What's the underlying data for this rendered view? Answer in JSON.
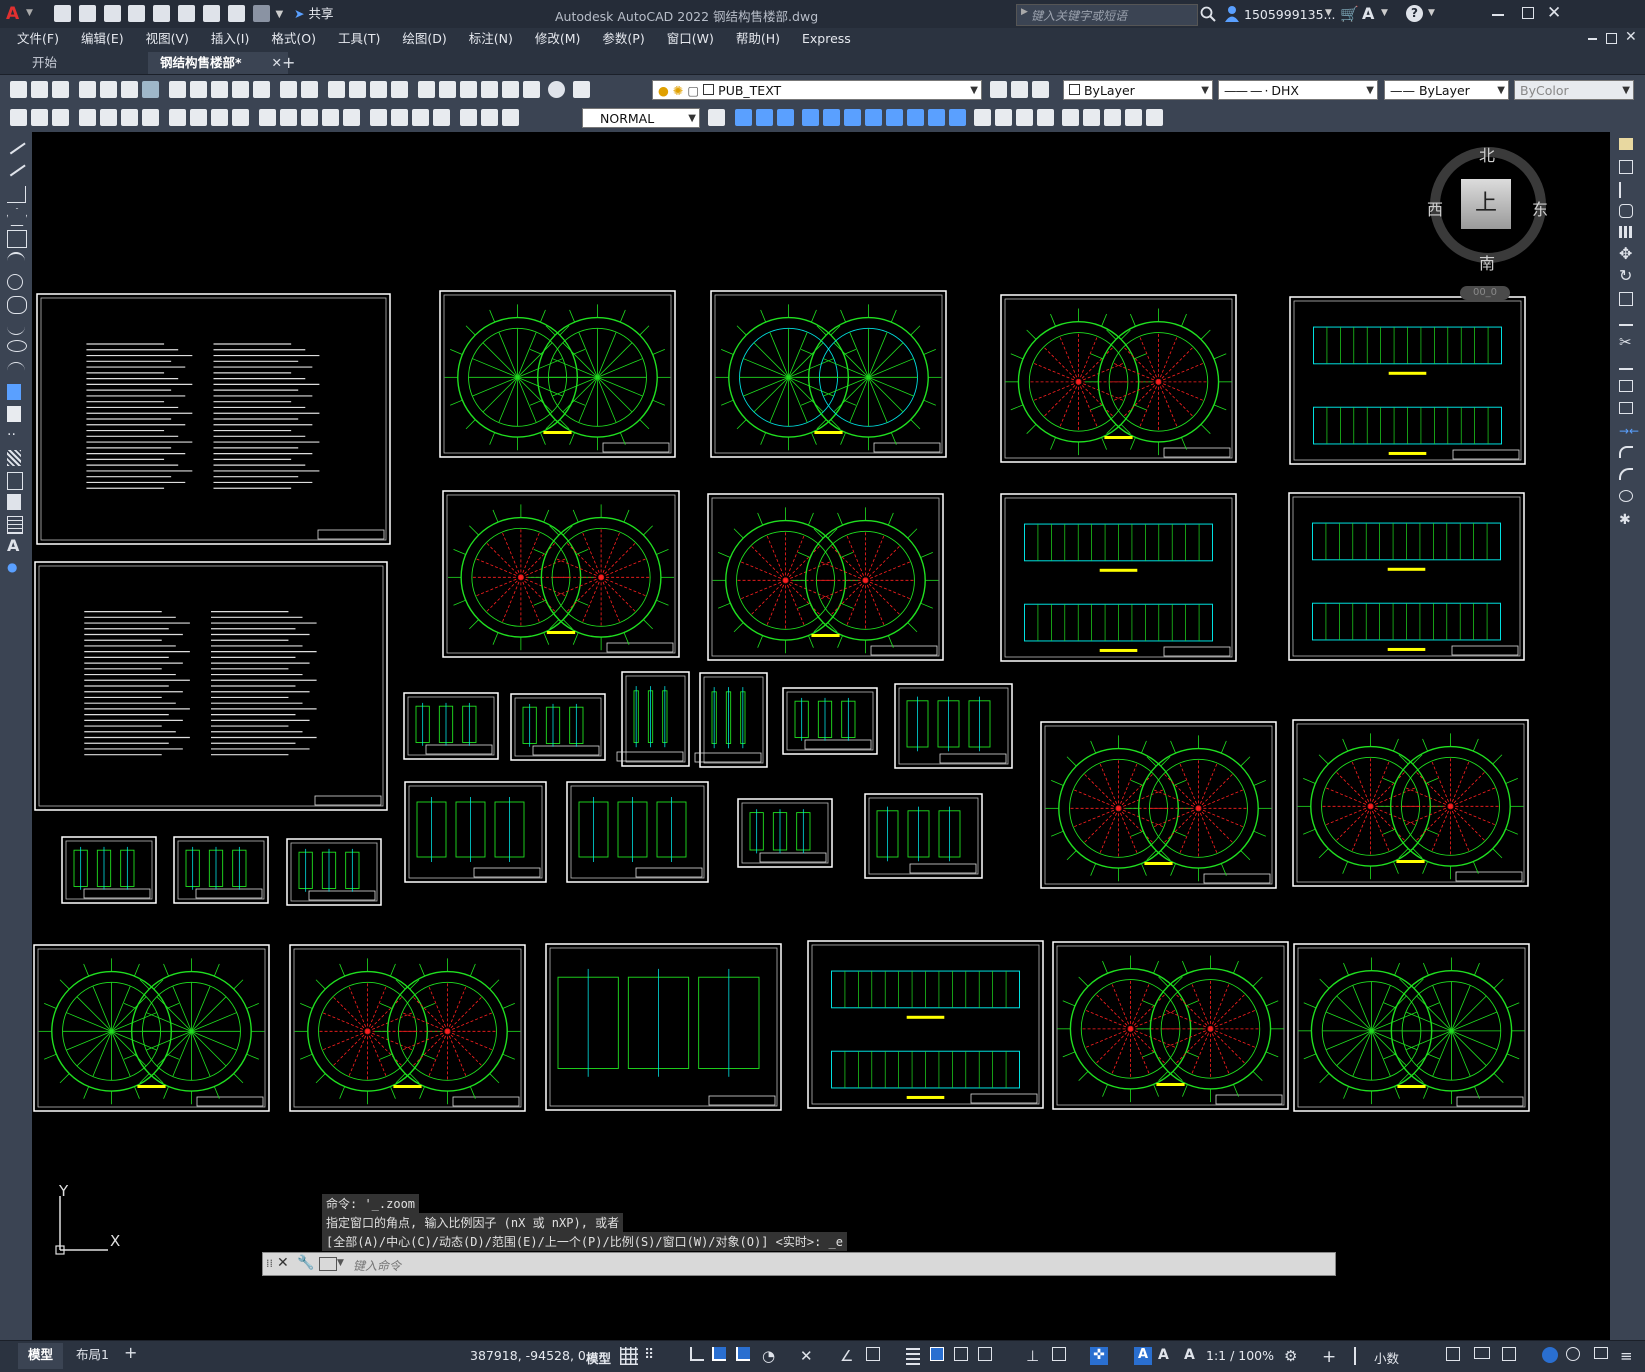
{
  "window": {
    "title": "Autodesk AutoCAD 2022    钢结构售楼部.dwg",
    "share_label": "共享",
    "search_placeholder": "键入关键字或短语",
    "user": "1505999135...",
    "app_letter": "A"
  },
  "menu": [
    "文件(F)",
    "编辑(E)",
    "视图(V)",
    "插入(I)",
    "格式(O)",
    "工具(T)",
    "绘图(D)",
    "标注(N)",
    "修改(M)",
    "参数(P)",
    "窗口(W)",
    "帮助(H)",
    "Express"
  ],
  "tabs": [
    {
      "label": "开始",
      "active": false
    },
    {
      "label": "钢结构售楼部*",
      "active": true
    }
  ],
  "toolbar1": {
    "layer": "PUB_TEXT",
    "color": "ByLayer",
    "linetype": "DHX",
    "lineweight": "ByLayer",
    "plotstyle": "ByColor"
  },
  "toolbar2": {
    "style": "NORMAL"
  },
  "viewcube": {
    "north": "北",
    "south": "南",
    "east": "东",
    "west": "西",
    "face": "上",
    "wcs": "00_0"
  },
  "ucs": {
    "x": "X",
    "y": "Y"
  },
  "command_history": [
    "命令: '_.zoom",
    "指定窗口的角点, 输入比例因子 (nX 或 nXP), 或者",
    "[全部(A)/中心(C)/动态(D)/范围(E)/上一个(P)/比例(S)/窗口(W)/对象(O)] <实时>: _e"
  ],
  "command_placeholder": "键入命令",
  "layout_tabs": [
    {
      "label": "模型",
      "active": true
    },
    {
      "label": "布局1",
      "active": false
    }
  ],
  "status": {
    "coords": "387918, -94528, 0",
    "model": "模型",
    "scale": "1:1 / 100%",
    "units": "小数"
  },
  "colors": {
    "titlebar": "#252c38",
    "toolbar": "#3b4453",
    "canvas": "#000000",
    "drawing_green": "#20e020",
    "drawing_red": "#ff2020",
    "drawing_cyan": "#00e0e0",
    "drawing_yellow": "#ffff00"
  }
}
